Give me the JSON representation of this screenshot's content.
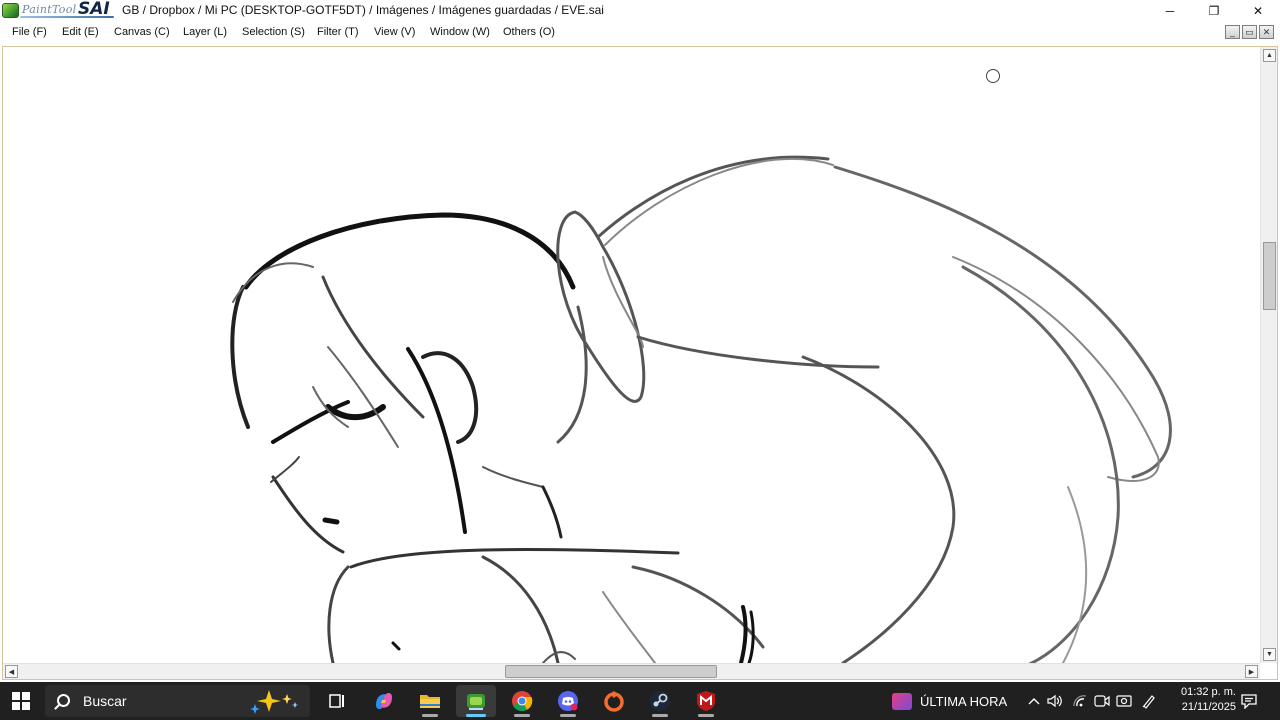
{
  "window": {
    "logo_text": "PaintTool",
    "logo_brand": "SAI",
    "title": "GB / Dropbox / Mi PC (DESKTOP-GOTF5DT) / Imágenes / Imágenes guardadas / EVE.sai",
    "minimize": "─",
    "restore": "❐",
    "close": "✕"
  },
  "menu": [
    {
      "label": "File (F)"
    },
    {
      "label": "Edit (E)"
    },
    {
      "label": "Canvas (C)"
    },
    {
      "label": "Layer (L)"
    },
    {
      "label": "Selection (S)"
    },
    {
      "label": "Filter (T)"
    },
    {
      "label": "View (V)"
    },
    {
      "label": "Window (W)"
    },
    {
      "label": "Others (O)"
    }
  ],
  "mdi": {
    "minimize": "_",
    "restore": "▭",
    "close": "✕"
  },
  "scrollbars": {
    "up": "▲",
    "down": "▼",
    "left": "◀",
    "right": "▶"
  },
  "taskbar": {
    "search_placeholder": "Buscar",
    "apps": [
      {
        "icon": "task-view-icon",
        "active": false
      },
      {
        "icon": "copilot-icon",
        "active": false
      },
      {
        "icon": "file-explorer-icon",
        "active": false
      },
      {
        "icon": "painttool-sai-icon",
        "active": true
      },
      {
        "icon": "chrome-icon",
        "active": false
      },
      {
        "icon": "discord-icon",
        "active": false
      },
      {
        "icon": "origin-icon",
        "active": false
      },
      {
        "icon": "steam-icon",
        "active": false
      },
      {
        "icon": "mcafee-icon",
        "active": false
      }
    ],
    "news_label": "ÚLTIMA HORA",
    "tray": {
      "chevron": "^",
      "volume": "🔊"
    },
    "time": "01:32 p. m.",
    "date": "21/11/2025"
  },
  "colors": {
    "taskbar_bg": "#202020",
    "active_accent": "#60cdff",
    "canvas_border": "#d8c49c"
  }
}
